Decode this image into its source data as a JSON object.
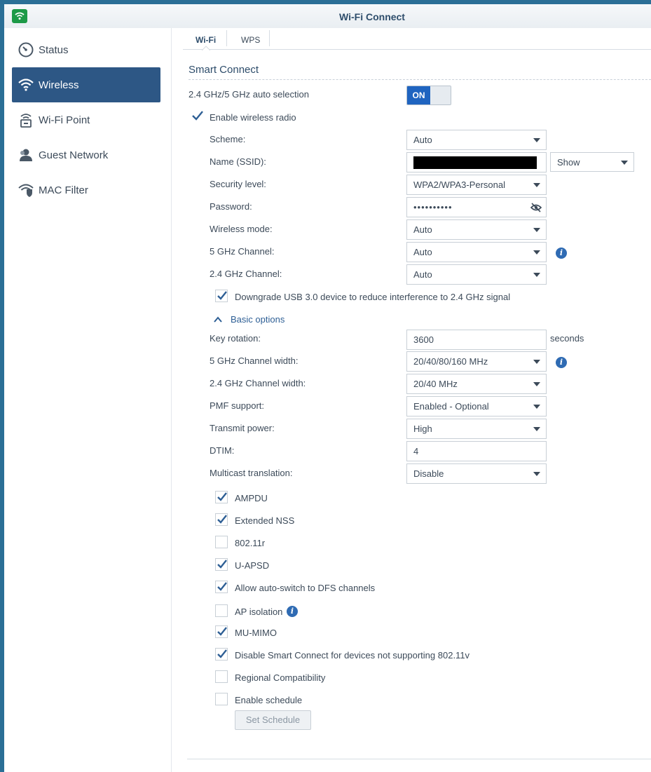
{
  "window": {
    "title": "Wi-Fi Connect"
  },
  "sidebar": {
    "items": [
      {
        "label": "Status",
        "icon": "gauge-icon"
      },
      {
        "label": "Wireless",
        "icon": "wifi-icon",
        "active": true
      },
      {
        "label": "Wi-Fi Point",
        "icon": "router-icon"
      },
      {
        "label": "Guest Network",
        "icon": "guest-user-icon"
      },
      {
        "label": "MAC Filter",
        "icon": "wifi-shield-icon"
      }
    ]
  },
  "tabs": [
    {
      "label": "Wi-Fi",
      "active": true
    },
    {
      "label": "WPS",
      "active": false
    }
  ],
  "section": {
    "title": "Smart Connect"
  },
  "auto_selection": {
    "label": "2.4 GHz/5 GHz auto selection",
    "toggle_text": "ON",
    "state": "on"
  },
  "enable_radio": {
    "label": "Enable wireless radio",
    "checked": true
  },
  "fields": {
    "scheme": {
      "label": "Scheme:",
      "value": "Auto"
    },
    "ssid": {
      "label": "Name (SSID):",
      "value": "",
      "show_select": "Show"
    },
    "security": {
      "label": "Security level:",
      "value": "WPA2/WPA3-Personal"
    },
    "password": {
      "label": "Password:",
      "value": "••••••••••"
    },
    "wireless_mode": {
      "label": "Wireless mode:",
      "value": "Auto"
    },
    "channel_5": {
      "label": "5 GHz Channel:",
      "value": "Auto"
    },
    "channel_24": {
      "label": "2.4 GHz Channel:",
      "value": "Auto"
    }
  },
  "downgrade_usb": {
    "label": "Downgrade USB 3.0 device to reduce interference to 2.4 GHz signal",
    "checked": true
  },
  "basic_options": {
    "label": "Basic options",
    "expanded": true
  },
  "basic": {
    "key_rotation": {
      "label": "Key rotation:",
      "value": "3600",
      "unit": "seconds"
    },
    "width_5": {
      "label": "5 GHz Channel width:",
      "value": "20/40/80/160 MHz"
    },
    "width_24": {
      "label": "2.4 GHz Channel width:",
      "value": "20/40 MHz"
    },
    "pmf": {
      "label": "PMF support:",
      "value": "Enabled - Optional"
    },
    "tx_power": {
      "label": "Transmit power:",
      "value": "High"
    },
    "dtim": {
      "label": "DTIM:",
      "value": "4"
    },
    "multicast": {
      "label": "Multicast translation:",
      "value": "Disable"
    }
  },
  "checkboxes": [
    {
      "label": "AMPDU",
      "checked": true
    },
    {
      "label": "Extended NSS",
      "checked": true
    },
    {
      "label": "802.11r",
      "checked": false
    },
    {
      "label": "U-APSD",
      "checked": true
    },
    {
      "label": "Allow auto-switch to DFS channels",
      "checked": true
    },
    {
      "label": "AP isolation",
      "checked": false
    },
    {
      "label": "MU-MIMO",
      "checked": true
    },
    {
      "label": "Disable Smart Connect for devices not supporting 802.11v",
      "checked": true
    },
    {
      "label": "Regional Compatibility",
      "checked": false
    },
    {
      "label": "Enable schedule",
      "checked": false
    }
  ],
  "set_schedule": {
    "label": "Set Schedule"
  },
  "colors": {
    "accent": "#2d5785",
    "toggle_on": "#1f64c0",
    "info": "#2f6bb3",
    "app_icon": "#1d9a47"
  }
}
